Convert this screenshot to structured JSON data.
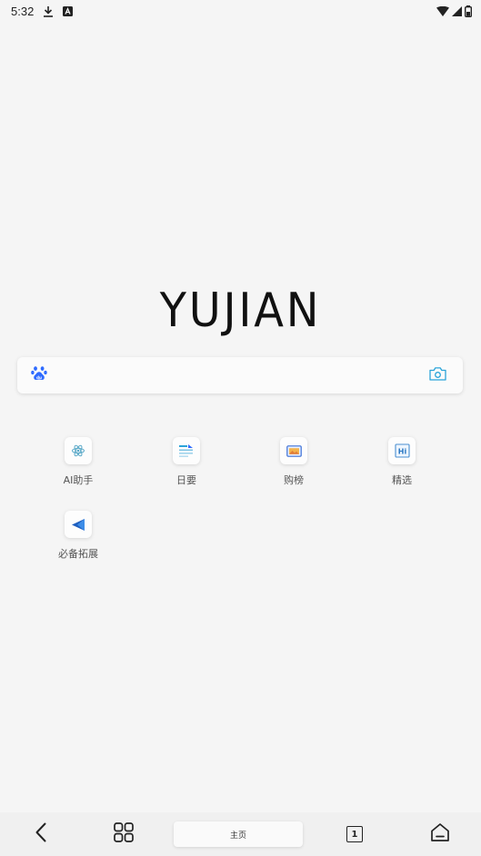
{
  "status_bar": {
    "time": "5:32",
    "icons": [
      "download-icon",
      "a-icon",
      "wifi-icon",
      "cellular-icon",
      "battery-icon"
    ]
  },
  "logo": {
    "text": "YUJIAN"
  },
  "search": {
    "placeholder": "",
    "value": "",
    "left_icon": "baidu-paw-icon",
    "right_icon": "camera-icon"
  },
  "shortcuts": [
    {
      "label": "AI助手",
      "icon": "ai-assistant-icon"
    },
    {
      "label": "日要",
      "icon": "daily-news-icon"
    },
    {
      "label": "购榜",
      "icon": "shopping-rank-icon"
    },
    {
      "label": "精选",
      "icon": "featured-icon"
    },
    {
      "label": "必备拓展",
      "icon": "extension-icon"
    }
  ],
  "bottom_nav": {
    "home_label": "主页",
    "tab_count": "1",
    "icons": [
      "back-icon",
      "grid-menu-icon",
      "tabs-icon",
      "home-icon"
    ]
  },
  "colors": {
    "background": "#f5f5f5",
    "accent_blue": "#2f6bff",
    "camera_teal": "#2ba4d9"
  }
}
